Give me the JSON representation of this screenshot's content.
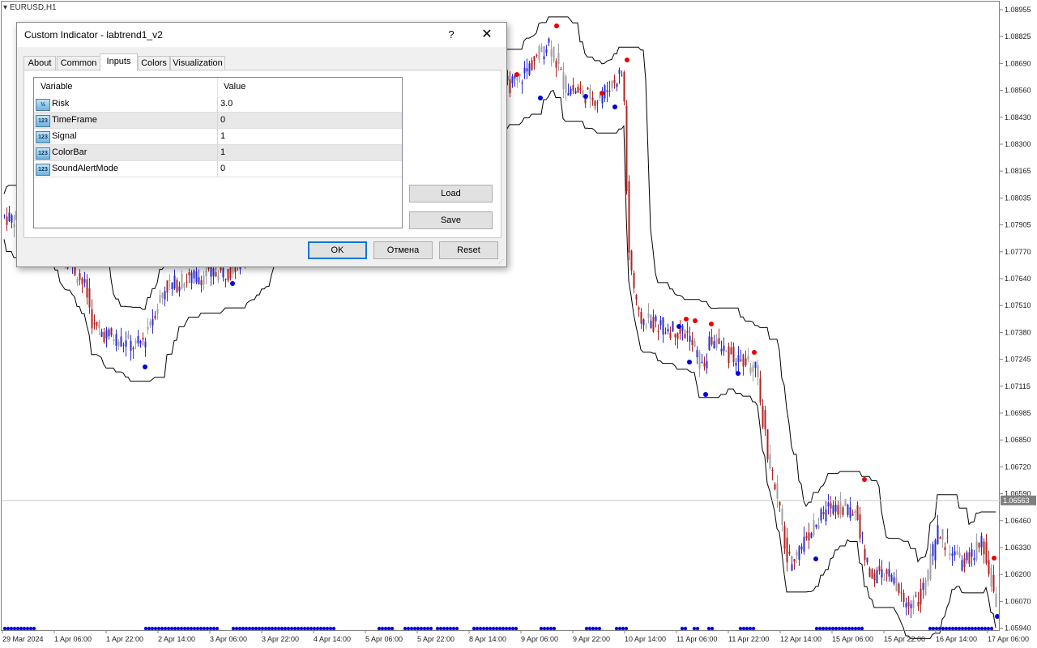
{
  "chart": {
    "symbol": "EURUSD,H1",
    "price_labels": [
      "1.08955",
      "1.08825",
      "1.08690",
      "1.08560",
      "1.08430",
      "1.08300",
      "1.08165",
      "1.08035",
      "1.07905",
      "1.07770",
      "1.07640",
      "1.07510",
      "1.07380",
      "1.07245",
      "1.07115",
      "1.06985",
      "1.06850",
      "1.06720",
      "1.06590",
      "1.06460",
      "1.06330",
      "1.06200",
      "1.06070",
      "1.05940"
    ],
    "current_price": "1.06563",
    "time_labels": [
      "29 Mar 2024",
      "1 Apr 06:00",
      "1 Apr 22:00",
      "2 Apr 14:00",
      "3 Apr 06:00",
      "3 Apr 22:00",
      "4 Apr 14:00",
      "5 Apr 06:00",
      "5 Apr 22:00",
      "8 Apr 14:00",
      "9 Apr 06:00",
      "9 Apr 22:00",
      "10 Apr 14:00",
      "11 Apr 06:00",
      "11 Apr 22:00",
      "12 Apr 14:00",
      "15 Apr 06:00",
      "15 Apr 22:00",
      "16 Apr 14:00",
      "17 Apr 06:00"
    ],
    "colors": {
      "bull": "#2b2bd0",
      "bear": "#b22222",
      "neutral": "#a0a0a0",
      "buy_dot": "#0000dd",
      "sell_dot": "#ee0000",
      "band": "#000000",
      "axis": "#808080"
    }
  },
  "dialog": {
    "title": "Custom Indicator - labtrend1_v2",
    "help": "?",
    "close": "✕",
    "tabs": [
      {
        "label": "About"
      },
      {
        "label": "Common"
      },
      {
        "label": "Inputs",
        "active": true
      },
      {
        "label": "Colors"
      },
      {
        "label": "Visualization"
      }
    ],
    "grid": {
      "col_variable": "Variable",
      "col_value": "Value",
      "rows": [
        {
          "icon": "½",
          "name": "Risk",
          "value": "3.0"
        },
        {
          "icon": "123",
          "name": "TimeFrame",
          "value": "0"
        },
        {
          "icon": "123",
          "name": "Signal",
          "value": "1"
        },
        {
          "icon": "123",
          "name": "ColorBar",
          "value": "1"
        },
        {
          "icon": "123",
          "name": "SoundAlertMode",
          "value": "0"
        }
      ]
    },
    "buttons": {
      "load": "Load",
      "save": "Save",
      "ok": "OK",
      "cancel": "Отмена",
      "reset": "Reset"
    }
  }
}
